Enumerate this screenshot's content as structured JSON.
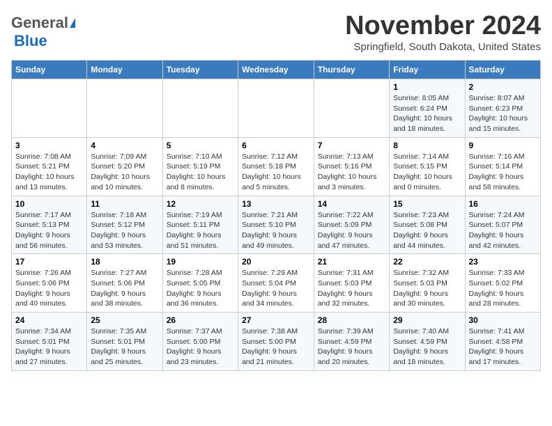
{
  "logo": {
    "general": "General",
    "blue": "Blue"
  },
  "title": "November 2024",
  "subtitle": "Springfield, South Dakota, United States",
  "days_header": [
    "Sunday",
    "Monday",
    "Tuesday",
    "Wednesday",
    "Thursday",
    "Friday",
    "Saturday"
  ],
  "weeks": [
    [
      {
        "num": "",
        "info": ""
      },
      {
        "num": "",
        "info": ""
      },
      {
        "num": "",
        "info": ""
      },
      {
        "num": "",
        "info": ""
      },
      {
        "num": "",
        "info": ""
      },
      {
        "num": "1",
        "info": "Sunrise: 8:05 AM\nSunset: 6:24 PM\nDaylight: 10 hours\nand 18 minutes."
      },
      {
        "num": "2",
        "info": "Sunrise: 8:07 AM\nSunset: 6:23 PM\nDaylight: 10 hours\nand 15 minutes."
      }
    ],
    [
      {
        "num": "3",
        "info": "Sunrise: 7:08 AM\nSunset: 5:21 PM\nDaylight: 10 hours\nand 13 minutes."
      },
      {
        "num": "4",
        "info": "Sunrise: 7:09 AM\nSunset: 5:20 PM\nDaylight: 10 hours\nand 10 minutes."
      },
      {
        "num": "5",
        "info": "Sunrise: 7:10 AM\nSunset: 5:19 PM\nDaylight: 10 hours\nand 8 minutes."
      },
      {
        "num": "6",
        "info": "Sunrise: 7:12 AM\nSunset: 5:18 PM\nDaylight: 10 hours\nand 5 minutes."
      },
      {
        "num": "7",
        "info": "Sunrise: 7:13 AM\nSunset: 5:16 PM\nDaylight: 10 hours\nand 3 minutes."
      },
      {
        "num": "8",
        "info": "Sunrise: 7:14 AM\nSunset: 5:15 PM\nDaylight: 10 hours\nand 0 minutes."
      },
      {
        "num": "9",
        "info": "Sunrise: 7:16 AM\nSunset: 5:14 PM\nDaylight: 9 hours\nand 58 minutes."
      }
    ],
    [
      {
        "num": "10",
        "info": "Sunrise: 7:17 AM\nSunset: 5:13 PM\nDaylight: 9 hours\nand 56 minutes."
      },
      {
        "num": "11",
        "info": "Sunrise: 7:18 AM\nSunset: 5:12 PM\nDaylight: 9 hours\nand 53 minutes."
      },
      {
        "num": "12",
        "info": "Sunrise: 7:19 AM\nSunset: 5:11 PM\nDaylight: 9 hours\nand 51 minutes."
      },
      {
        "num": "13",
        "info": "Sunrise: 7:21 AM\nSunset: 5:10 PM\nDaylight: 9 hours\nand 49 minutes."
      },
      {
        "num": "14",
        "info": "Sunrise: 7:22 AM\nSunset: 5:09 PM\nDaylight: 9 hours\nand 47 minutes."
      },
      {
        "num": "15",
        "info": "Sunrise: 7:23 AM\nSunset: 5:08 PM\nDaylight: 9 hours\nand 44 minutes."
      },
      {
        "num": "16",
        "info": "Sunrise: 7:24 AM\nSunset: 5:07 PM\nDaylight: 9 hours\nand 42 minutes."
      }
    ],
    [
      {
        "num": "17",
        "info": "Sunrise: 7:26 AM\nSunset: 5:06 PM\nDaylight: 9 hours\nand 40 minutes."
      },
      {
        "num": "18",
        "info": "Sunrise: 7:27 AM\nSunset: 5:06 PM\nDaylight: 9 hours\nand 38 minutes."
      },
      {
        "num": "19",
        "info": "Sunrise: 7:28 AM\nSunset: 5:05 PM\nDaylight: 9 hours\nand 36 minutes."
      },
      {
        "num": "20",
        "info": "Sunrise: 7:29 AM\nSunset: 5:04 PM\nDaylight: 9 hours\nand 34 minutes."
      },
      {
        "num": "21",
        "info": "Sunrise: 7:31 AM\nSunset: 5:03 PM\nDaylight: 9 hours\nand 32 minutes."
      },
      {
        "num": "22",
        "info": "Sunrise: 7:32 AM\nSunset: 5:03 PM\nDaylight: 9 hours\nand 30 minutes."
      },
      {
        "num": "23",
        "info": "Sunrise: 7:33 AM\nSunset: 5:02 PM\nDaylight: 9 hours\nand 28 minutes."
      }
    ],
    [
      {
        "num": "24",
        "info": "Sunrise: 7:34 AM\nSunset: 5:01 PM\nDaylight: 9 hours\nand 27 minutes."
      },
      {
        "num": "25",
        "info": "Sunrise: 7:35 AM\nSunset: 5:01 PM\nDaylight: 9 hours\nand 25 minutes."
      },
      {
        "num": "26",
        "info": "Sunrise: 7:37 AM\nSunset: 5:00 PM\nDaylight: 9 hours\nand 23 minutes."
      },
      {
        "num": "27",
        "info": "Sunrise: 7:38 AM\nSunset: 5:00 PM\nDaylight: 9 hours\nand 21 minutes."
      },
      {
        "num": "28",
        "info": "Sunrise: 7:39 AM\nSunset: 4:59 PM\nDaylight: 9 hours\nand 20 minutes."
      },
      {
        "num": "29",
        "info": "Sunrise: 7:40 AM\nSunset: 4:59 PM\nDaylight: 9 hours\nand 18 minutes."
      },
      {
        "num": "30",
        "info": "Sunrise: 7:41 AM\nSunset: 4:58 PM\nDaylight: 9 hours\nand 17 minutes."
      }
    ]
  ]
}
